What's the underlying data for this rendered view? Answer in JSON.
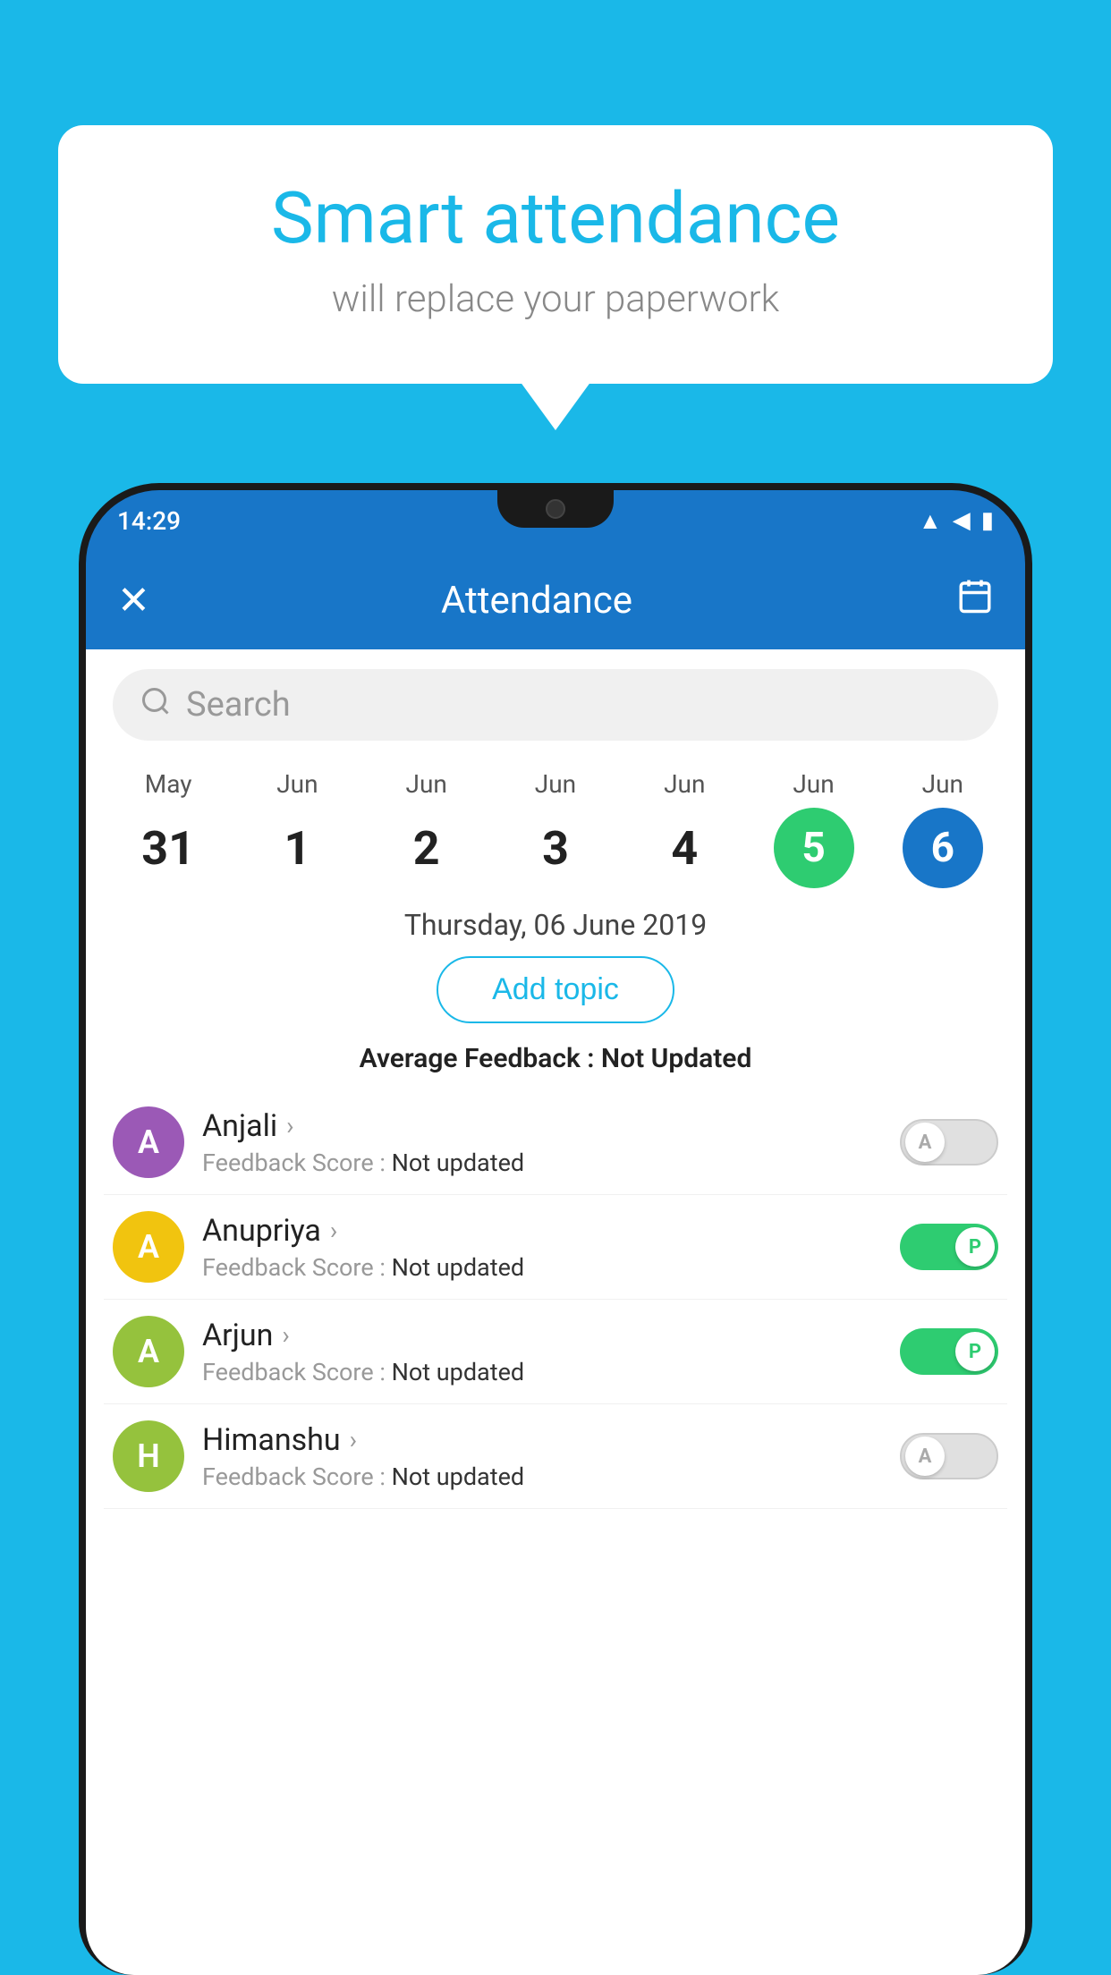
{
  "background_color": "#1ab8e8",
  "bubble": {
    "title": "Smart attendance",
    "subtitle": "will replace your paperwork"
  },
  "phone": {
    "status_bar": {
      "time": "14:29",
      "icons": [
        "wifi",
        "signal",
        "battery"
      ]
    },
    "app_bar": {
      "close_label": "✕",
      "title": "Attendance",
      "calendar_icon": "📅"
    },
    "search": {
      "placeholder": "Search"
    },
    "calendar": {
      "days": [
        {
          "month": "May",
          "num": "31",
          "state": "normal"
        },
        {
          "month": "Jun",
          "num": "1",
          "state": "normal"
        },
        {
          "month": "Jun",
          "num": "2",
          "state": "normal"
        },
        {
          "month": "Jun",
          "num": "3",
          "state": "normal"
        },
        {
          "month": "Jun",
          "num": "4",
          "state": "normal"
        },
        {
          "month": "Jun",
          "num": "5",
          "state": "today"
        },
        {
          "month": "Jun",
          "num": "6",
          "state": "selected"
        }
      ]
    },
    "selected_date": "Thursday, 06 June 2019",
    "add_topic_label": "Add topic",
    "avg_feedback_label": "Average Feedback :",
    "avg_feedback_value": "Not Updated",
    "students": [
      {
        "name": "Anjali",
        "initial": "A",
        "avatar_color": "#9b59b6",
        "feedback_label": "Feedback Score :",
        "feedback_value": "Not updated",
        "attendance": "off",
        "toggle_label": "A"
      },
      {
        "name": "Anupriya",
        "initial": "A",
        "avatar_color": "#f1c40f",
        "feedback_label": "Feedback Score :",
        "feedback_value": "Not updated",
        "attendance": "on",
        "toggle_label": "P"
      },
      {
        "name": "Arjun",
        "initial": "A",
        "avatar_color": "#95c23d",
        "feedback_label": "Feedback Score :",
        "feedback_value": "Not updated",
        "attendance": "on",
        "toggle_label": "P"
      },
      {
        "name": "Himanshu",
        "initial": "H",
        "avatar_color": "#95c23d",
        "feedback_label": "Feedback Score :",
        "feedback_value": "Not updated",
        "attendance": "off",
        "toggle_label": "A"
      }
    ]
  }
}
